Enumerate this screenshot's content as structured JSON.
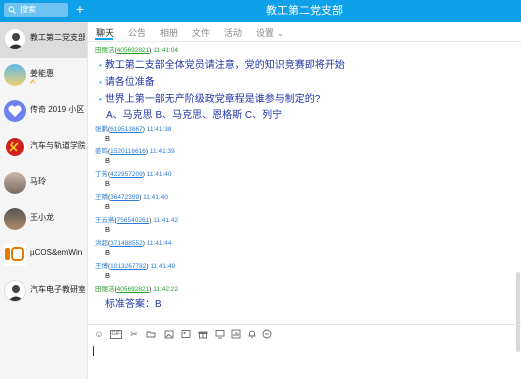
{
  "app": {
    "title": "教工第二党支部",
    "search_placeholder": "搜索"
  },
  "sidebar": {
    "items": [
      {
        "name": "教工第二党支部",
        "sub": ""
      },
      {
        "name": "姜能惠",
        "sub": "✍"
      },
      {
        "name": "传奇 2019 小区",
        "sub": ""
      },
      {
        "name": "汽车与轨道学院",
        "sub": ""
      },
      {
        "name": "马玲",
        "sub": ""
      },
      {
        "name": "王小龙",
        "sub": ""
      },
      {
        "name": "μCOS&emWin",
        "sub": ""
      },
      {
        "name": "汽车电子教研室",
        "sub": ""
      }
    ]
  },
  "tabs": [
    "聊天",
    "公告",
    "相册",
    "文件",
    "活动",
    "设置 ⌄"
  ],
  "messages": [
    {
      "user": "田丽洁",
      "qq": "405692821",
      "time": "11:41:04",
      "lines": [
        "教工第二支部全体党员请注意，党的知识竞赛即将开始",
        "请各位准备",
        "世界上第一部无产阶级政党章程是谁参与制定的?",
        "A、马克思 B、马克思、恩格斯 C、列宁"
      ]
    },
    {
      "user": "张鹏",
      "qq": "619513867",
      "time": "11:41:38",
      "lines": [
        "B"
      ]
    },
    {
      "user": "姜鸣",
      "qq": "1520116616",
      "time": "11:41:39",
      "lines": [
        "B"
      ]
    },
    {
      "user": "丁芳",
      "qq": "422957209",
      "time": "11:41:40",
      "lines": [
        "B"
      ]
    },
    {
      "user": "王晴",
      "qq": "36472399",
      "time": "11:41:40",
      "lines": [
        "B"
      ]
    },
    {
      "user": "王云燕",
      "qq": "756540261",
      "time": "11:41:42",
      "lines": [
        "B"
      ]
    },
    {
      "user": "洪超",
      "qq": "371488552",
      "time": "11:41:44",
      "lines": [
        "B"
      ]
    },
    {
      "user": "王博",
      "qq": "1013267782",
      "time": "11:41:49",
      "lines": [
        "B"
      ]
    },
    {
      "user": "田丽洁",
      "qq": "405692821",
      "time": "11:42:22",
      "lines": [
        "标准答案：B"
      ]
    }
  ],
  "toolbar": [
    "smile-icon",
    "gif-icon",
    "scissors-icon",
    "folder-icon",
    "image-folder-icon",
    "picture-icon",
    "gift-icon",
    "screen-icon",
    "chart-icon",
    "bell-icon",
    "more-icon"
  ],
  "colors": {
    "accent": "#0fa0ea",
    "username": "#2a7cd4",
    "message": "#2236a6",
    "admin": "#279a2c"
  }
}
